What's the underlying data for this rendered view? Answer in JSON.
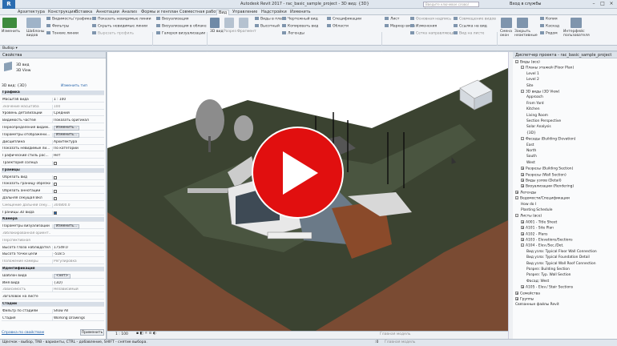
{
  "app": {
    "title": "Autodesk Revit 2017 -   rac_basic_sample_project - 3D вид: {3D}",
    "search_placeholder": "Введите ключевое слово/фразу",
    "signin": "Вход в службы"
  },
  "tabs": [
    "Архитектура",
    "Конструкция",
    "Вставка",
    "Аннотации",
    "Анализ",
    "Формы и генплан",
    "Совместная работа",
    "Вид",
    "Управление",
    "Надстройки",
    "Изменить"
  ],
  "active_tab": "Вид",
  "ribbon": {
    "modify": "Изменить",
    "templates": "Шаблоны видов",
    "graphics_items": [
      "Видимость/ графика",
      "Фильтры",
      "Тонкие линии"
    ],
    "graphics_items2": [
      "Показать невидимые линии",
      "Скрыть невидимые линии",
      "Вырезать профиль"
    ],
    "render_items": [
      "Визуализация",
      "Визуализация в облаке",
      "Галерея визуализации"
    ],
    "create_big": [
      "3D вид",
      "Разрез",
      "Фрагмент"
    ],
    "create_items": [
      "Виды в плане",
      "Высотный",
      "Легенды"
    ],
    "create_items2": [
      "Чертежный вид",
      "Копировать вид",
      "Легенды"
    ],
    "create_items3": [
      "Спецификации",
      "Области",
      "Ведомость"
    ],
    "sheet_items": [
      "Лист",
      "Маркер вида",
      "Шаблон листа"
    ],
    "sheet_items2": [
      "Основная надпись",
      "Изменения",
      "Сетка направляющих"
    ],
    "sheet_items3": [
      "Совмещение видов",
      "Ссылка на вид",
      "Вид на листе"
    ],
    "window_items": [
      "Смена окон",
      "Закрыть неактивные",
      "Копия",
      "Каскад",
      "Рядом"
    ],
    "ui_item": "Интерфейс пользователя",
    "panels": [
      "Графика",
      "Презентация",
      "Создание",
      "Композиция листов",
      "Окна"
    ],
    "select_label": "Выбор ▾"
  },
  "properties": {
    "header": "Свойства",
    "type_name": "3D вид",
    "type_sub": "3D View",
    "filter": "3D вид: {3D}",
    "edit_type": "Изменить тип",
    "rows": [
      {
        "k": "Графика",
        "v": "",
        "sec": true
      },
      {
        "k": "Масштаб вида",
        "v": "1 : 100"
      },
      {
        "k": "Значение масштаба",
        "v": "100",
        "gray": true
      },
      {
        "k": "Уровень детализации",
        "v": "Средний"
      },
      {
        "k": "Видимость частей",
        "v": "Показать оригинал"
      },
      {
        "k": "Переопределения видим...",
        "v": "Изменить...",
        "btn": true
      },
      {
        "k": "Параметры отображени...",
        "v": "Изменить...",
        "btn": true
      },
      {
        "k": "Дисциплина",
        "v": "Архитектура"
      },
      {
        "k": "Показать невидимые ли...",
        "v": "По категории"
      },
      {
        "k": "Графический стиль рас...",
        "v": "Нет"
      },
      {
        "k": "Траектория солнца",
        "v": "",
        "chk": false
      },
      {
        "k": "Границы",
        "v": "",
        "sec": true
      },
      {
        "k": "Обрезать вид",
        "v": "",
        "chk": false
      },
      {
        "k": "Показать границу обрезки",
        "v": "",
        "chk": false
      },
      {
        "k": "Обрезать аннотации",
        "v": "",
        "chk": false
      },
      {
        "k": "Дальняя секущая Вкл",
        "v": "",
        "chk": false
      },
      {
        "k": "Смещение дальней секу...",
        "v": "304800.0",
        "gray": true
      },
      {
        "k": "Границы 3D вида",
        "v": "",
        "chk": true
      },
      {
        "k": "Камера",
        "v": "",
        "sec": true
      },
      {
        "k": "Параметры визуализации",
        "v": "Изменить...",
        "btn": true
      },
      {
        "k": "Заблокированная ориент...",
        "v": "",
        "gray": true
      },
      {
        "k": "Перспективная",
        "v": "",
        "gray": true
      },
      {
        "k": "Высота глаза наблюдателя",
        "v": "17549.0"
      },
      {
        "k": "Высота точки цели",
        "v": "-518.5"
      },
      {
        "k": "Положение камеры",
        "v": "Регулировка",
        "gray": true
      },
      {
        "k": "Идентификация",
        "v": "",
        "sec": true
      },
      {
        "k": "Шаблон вида",
        "v": "<нет>",
        "btn": true
      },
      {
        "k": "Имя вида",
        "v": "{3D}"
      },
      {
        "k": "Зависимость",
        "v": "Независимый",
        "gray": true
      },
      {
        "k": "Заголовок на листе",
        "v": ""
      },
      {
        "k": "Стадии",
        "v": "",
        "sec": true
      },
      {
        "k": "Фильтр по стадиям",
        "v": "Show All"
      },
      {
        "k": "Стадия",
        "v": "Working Drawings"
      }
    ],
    "help": "Справка по свойствам",
    "apply": "Применить"
  },
  "browser": {
    "header": "Диспетчер проекта - rac_basic_sample_project",
    "items": [
      {
        "t": "Виды (все)",
        "lv": 0,
        "tg": "-"
      },
      {
        "t": "Планы этажей (Floor Plan)",
        "lv": 1,
        "tg": "-"
      },
      {
        "t": "Level 1",
        "lv": 2
      },
      {
        "t": "Level 2",
        "lv": 2
      },
      {
        "t": "Site",
        "lv": 2
      },
      {
        "t": "3D виды (3D View)",
        "lv": 1,
        "tg": "-"
      },
      {
        "t": "Approach",
        "lv": 2
      },
      {
        "t": "From Yard",
        "lv": 2
      },
      {
        "t": "Kitchen",
        "lv": 2
      },
      {
        "t": "Living Room",
        "lv": 2
      },
      {
        "t": "Section Perspective",
        "lv": 2
      },
      {
        "t": "Solar Analysis",
        "lv": 2
      },
      {
        "t": "{3D}",
        "lv": 2
      },
      {
        "t": "Фасады (Building Elevation)",
        "lv": 1,
        "tg": "-"
      },
      {
        "t": "East",
        "lv": 2
      },
      {
        "t": "North",
        "lv": 2
      },
      {
        "t": "South",
        "lv": 2
      },
      {
        "t": "West",
        "lv": 2
      },
      {
        "t": "Разрезы (Building Section)",
        "lv": 1,
        "tg": "+"
      },
      {
        "t": "Разрезы (Wall Section)",
        "lv": 1,
        "tg": "+"
      },
      {
        "t": "Виды узлов (Detail)",
        "lv": 1,
        "tg": "+"
      },
      {
        "t": "Визуализации (Rendering)",
        "lv": 1,
        "tg": "+"
      },
      {
        "t": "Легенды",
        "lv": 0,
        "tg": "+"
      },
      {
        "t": "Ведомости/Спецификации",
        "lv": 0,
        "tg": "-"
      },
      {
        "t": "How do I",
        "lv": 1
      },
      {
        "t": "Planting Schedule",
        "lv": 1
      },
      {
        "t": "Листы (все)",
        "lv": 0,
        "tg": "-"
      },
      {
        "t": "A001 - Title Sheet",
        "lv": 1,
        "tg": "+"
      },
      {
        "t": "A101 - Site Plan",
        "lv": 1,
        "tg": "+"
      },
      {
        "t": "A102 - Plans",
        "lv": 1,
        "tg": "+"
      },
      {
        "t": "A103 - Elevations/Sections",
        "lv": 1,
        "tg": "+"
      },
      {
        "t": "A104 - Elev./Sec./Det.",
        "lv": 1,
        "tg": "-"
      },
      {
        "t": "Вид узла: Typical Floor Wall Connection",
        "lv": 2
      },
      {
        "t": "Вид узла: Typical Foundation Detail",
        "lv": 2
      },
      {
        "t": "Вид узла: Typical Wall Roof Connection",
        "lv": 2
      },
      {
        "t": "Разрез: Building Section",
        "lv": 2
      },
      {
        "t": "Разрез: Typ. Wall Section",
        "lv": 2
      },
      {
        "t": "Фасад: West",
        "lv": 2
      },
      {
        "t": "A105 - Elev./ Stair Sections",
        "lv": 1,
        "tg": "+"
      },
      {
        "t": "Семейства",
        "lv": 0,
        "tg": "+"
      },
      {
        "t": "Группы",
        "lv": 0,
        "tg": "+"
      },
      {
        "t": "Связанные файлы Revit",
        "lv": 0
      }
    ]
  },
  "viewport": {
    "scale": "1 : 100",
    "main_model": "Главная модель"
  },
  "statusbar": {
    "hint": "Щелчок - выбор, TAB - варианты, CTRL - добавление, SHIFT - снятие выбора.",
    "zero": ":0",
    "model": "Главная модель"
  },
  "colors": {
    "play": "#e10f0f",
    "ground": "#3b4331",
    "terrain": "#7a4b33",
    "sky": "#ffffff"
  }
}
